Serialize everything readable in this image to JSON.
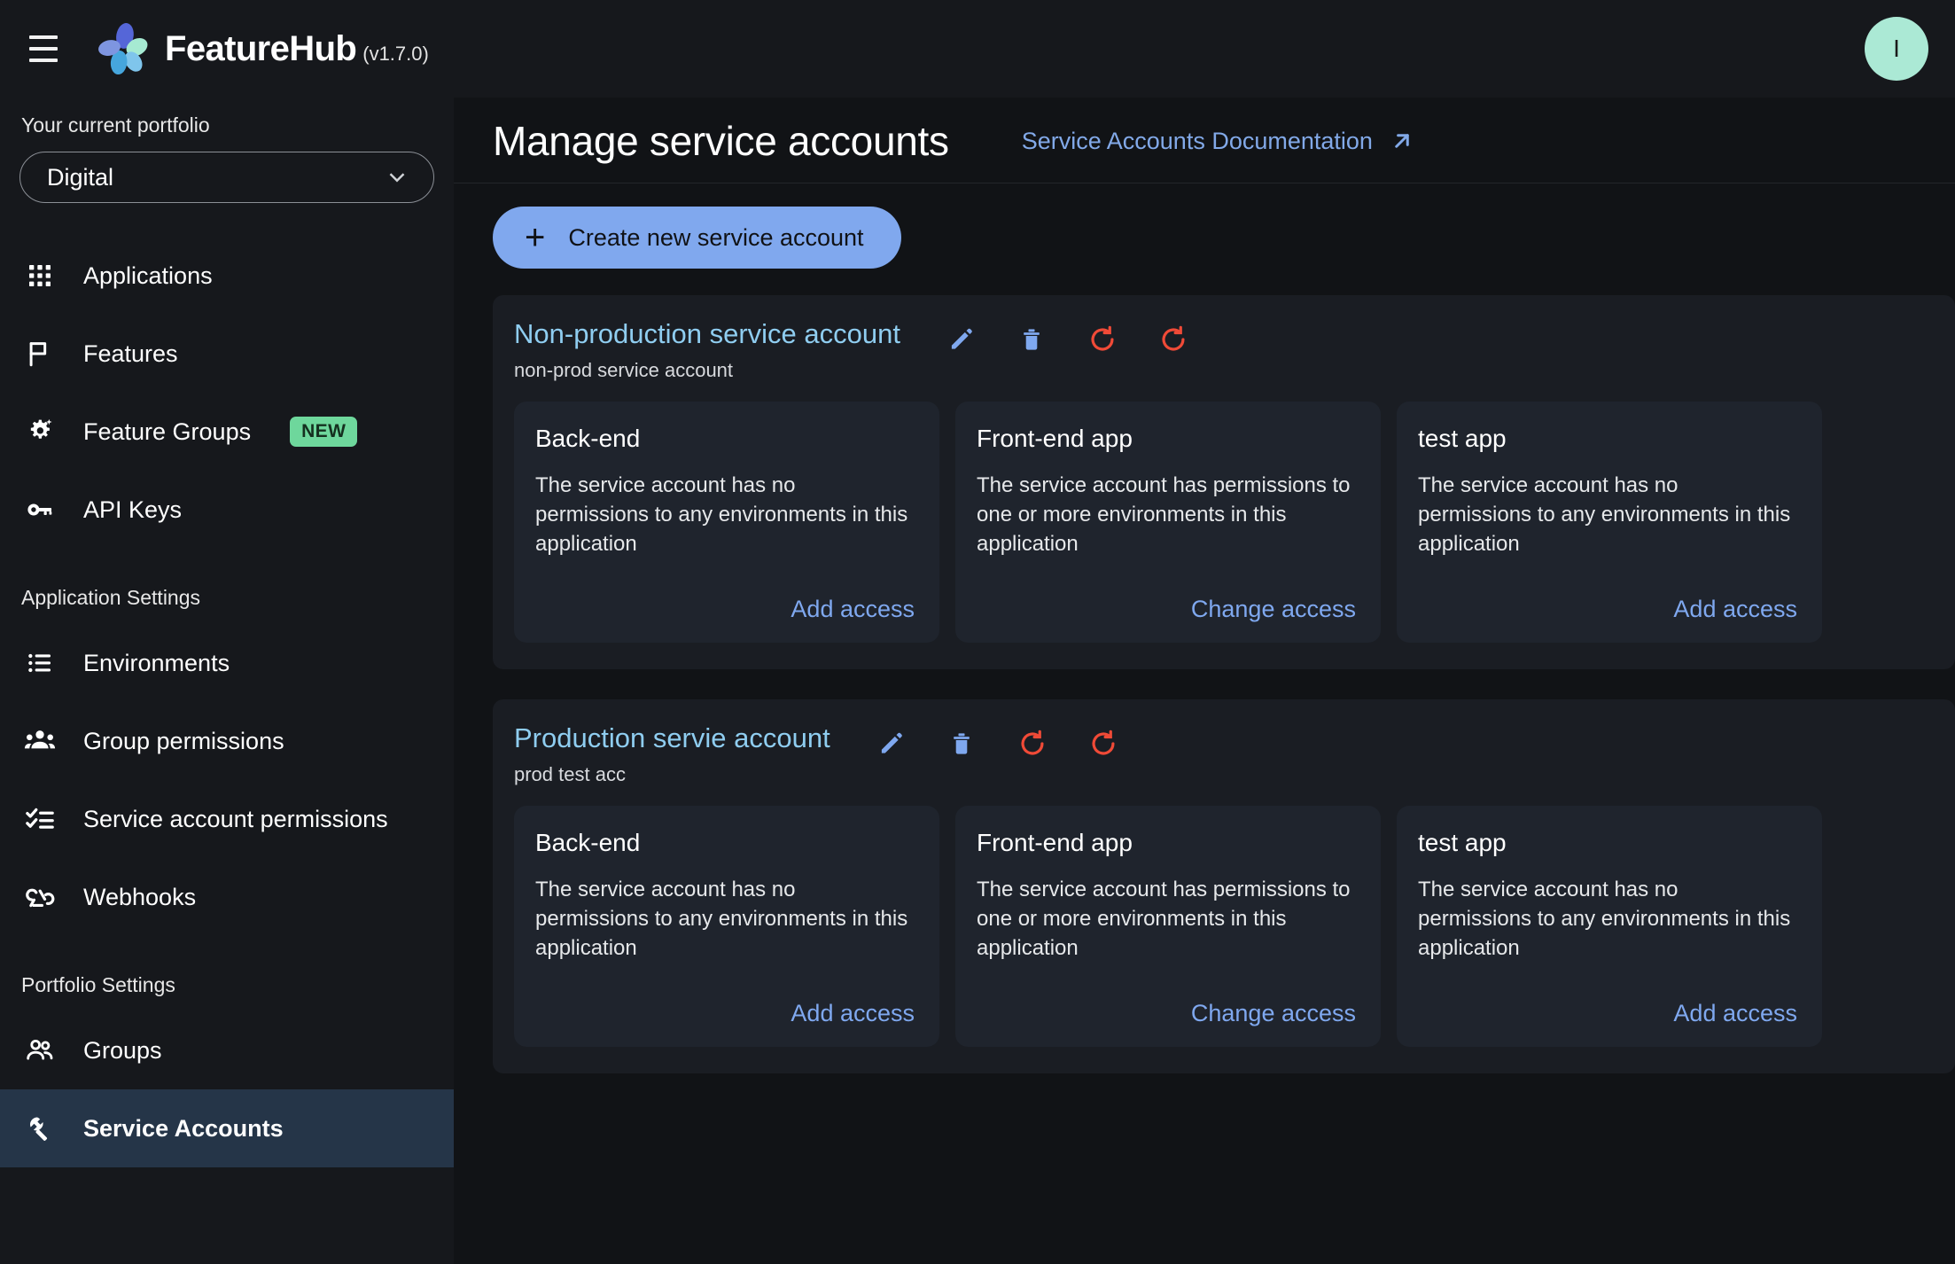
{
  "topbar": {
    "menu_icon": "hamburger-menu-icon",
    "brand_name": "FeatureHub",
    "version": "(v1.7.0)",
    "avatar_initial": "I"
  },
  "sidebar": {
    "portfolio_label": "Your current portfolio",
    "portfolio_value": "Digital",
    "nav": [
      {
        "label": "Applications",
        "icon": "apps-grid-icon",
        "active": false
      },
      {
        "label": "Features",
        "icon": "flag-icon",
        "active": false
      },
      {
        "label": "Feature Groups",
        "icon": "gear-sparkle-icon",
        "badge": "NEW",
        "active": false
      },
      {
        "label": "API Keys",
        "icon": "key-icon",
        "active": false
      }
    ],
    "app_settings_header": "Application Settings",
    "app_settings": [
      {
        "label": "Environments",
        "icon": "list-icon",
        "active": false
      },
      {
        "label": "Group permissions",
        "icon": "people-group-icon",
        "active": false
      },
      {
        "label": "Service account permissions",
        "icon": "checklist-icon",
        "active": false
      },
      {
        "label": "Webhooks",
        "icon": "webhook-icon",
        "active": false
      }
    ],
    "portfolio_settings_header": "Portfolio Settings",
    "portfolio_settings": [
      {
        "label": "Groups",
        "icon": "people-icon",
        "active": false
      },
      {
        "label": "Service Accounts",
        "icon": "wrench-icon",
        "active": true
      }
    ]
  },
  "main": {
    "title": "Manage service accounts",
    "doc_link": "Service Accounts Documentation",
    "doc_link_icon": "external-link-icon",
    "create_button": "Create new service account",
    "create_button_icon": "plus-icon",
    "accounts": [
      {
        "name": "Non-production service account",
        "description": "non-prod service account",
        "icons": [
          {
            "name": "edit-pencil-icon",
            "color": "#7fa8ef"
          },
          {
            "name": "delete-trash-icon",
            "color": "#7fa8ef"
          },
          {
            "name": "reset-refresh-icon",
            "color": "#f04a37"
          },
          {
            "name": "reset-refresh-icon",
            "color": "#f04a37"
          }
        ],
        "apps": [
          {
            "name": "Back-end",
            "description": "The service account has no permissions to any environments in this application",
            "link": "Add access"
          },
          {
            "name": "Front-end app",
            "description": "The service account has permissions to one or more environments in this application",
            "link": "Change access"
          },
          {
            "name": "test app",
            "description": "The service account has no permissions to any environments in this application",
            "link": "Add access"
          }
        ]
      },
      {
        "name": "Production servie account",
        "description": "prod test acc",
        "icons": [
          {
            "name": "edit-pencil-icon",
            "color": "#7fa8ef"
          },
          {
            "name": "delete-trash-icon",
            "color": "#7fa8ef"
          },
          {
            "name": "reset-refresh-icon",
            "color": "#f04a37"
          },
          {
            "name": "reset-refresh-icon",
            "color": "#f04a37"
          }
        ],
        "apps": [
          {
            "name": "Back-end",
            "description": "The service account has no permissions to any environments in this application",
            "link": "Add access"
          },
          {
            "name": "Front-end app",
            "description": "The service account has permissions to one or more environments in this application",
            "link": "Change access"
          },
          {
            "name": "test app",
            "description": "The service account has no permissions to any environments in this application",
            "link": "Add access"
          }
        ]
      }
    ]
  },
  "colors": {
    "accent_blue": "#80a8ee",
    "title_blue": "#8fcdf0",
    "danger_red": "#f04a37",
    "badge_green": "#6ed79c",
    "avatar_mint": "#abe9d5",
    "active_nav": "#253548"
  }
}
